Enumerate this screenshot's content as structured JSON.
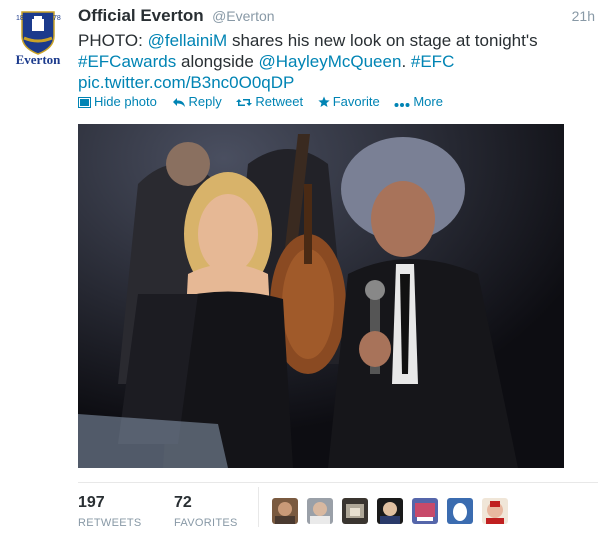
{
  "account": {
    "name": "Official Everton",
    "handle": "@Everton",
    "time": "21h",
    "avatar_text": "Everton"
  },
  "tweet": {
    "p1": "PHOTO: ",
    "m1": "@fellainiM",
    "p2": " shares his new look on stage at tonight's",
    "h1": "#EFCawards",
    "p3": " alongside ",
    "m2": "@HayleyMcQueen",
    "p4": ". ",
    "h2": "#EFC",
    "url": "pic.twitter.com/B3nc0O0qDP"
  },
  "actions": {
    "hide_photo": "Hide photo",
    "reply": "Reply",
    "retweet": "Retweet",
    "favorite": "Favorite",
    "more": "More"
  },
  "stats": {
    "retweets": "197",
    "retweets_label": "RETWEETS",
    "favorites": "72",
    "favorites_label": "FAVORITES"
  },
  "colors": {
    "link": "#0084b4",
    "everton_blue": "#1b3a8c"
  }
}
